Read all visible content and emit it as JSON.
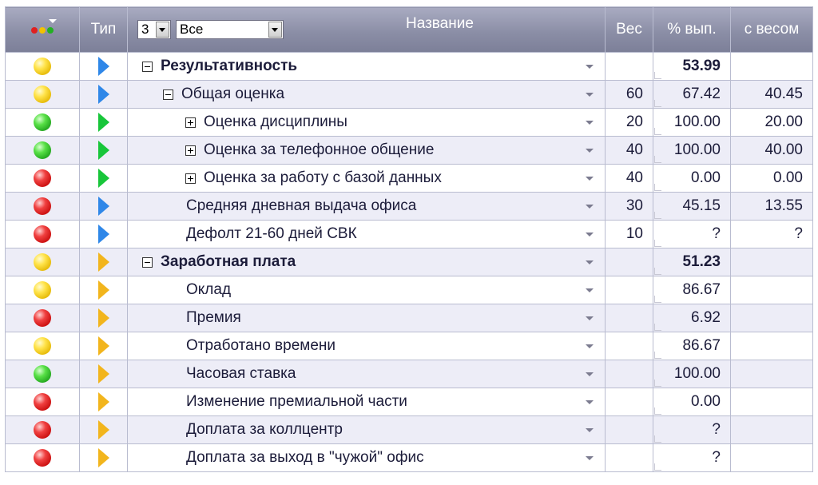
{
  "header": {
    "type_label": "Тип",
    "level_select": "3",
    "filter_select": "Все",
    "name_label": "Название",
    "weight_label": "Вес",
    "pct_label": "% вып.",
    "weighted_label": "с весом"
  },
  "colors": {
    "yellow": "#ffe34a",
    "green": "#1ea11b",
    "red": "#c70b0b",
    "type_blue": "#2f87e8",
    "type_green": "#18c63a",
    "type_orange": "#f2b51d"
  },
  "rows": [
    {
      "status": "yellow",
      "type": "blue",
      "level": 0,
      "toggle": "minus",
      "name": "Результативность",
      "bold": true,
      "weight": "",
      "pct": "53.99",
      "weighted": ""
    },
    {
      "status": "yellow",
      "type": "blue",
      "level": 1,
      "toggle": "minus",
      "name": "Общая оценка",
      "bold": false,
      "weight": "60",
      "pct": "67.42",
      "weighted": "40.45"
    },
    {
      "status": "green",
      "type": "green",
      "level": 2,
      "toggle": "plus",
      "name": "Оценка дисциплины",
      "bold": false,
      "weight": "20",
      "pct": "100.00",
      "weighted": "20.00"
    },
    {
      "status": "green",
      "type": "green",
      "level": 2,
      "toggle": "plus",
      "name": "Оценка за телефонное общение",
      "bold": false,
      "weight": "40",
      "pct": "100.00",
      "weighted": "40.00"
    },
    {
      "status": "red",
      "type": "green",
      "level": 2,
      "toggle": "plus",
      "name": "Оценка за работу с базой данных",
      "bold": false,
      "weight": "40",
      "pct": "0.00",
      "weighted": "0.00"
    },
    {
      "status": "red",
      "type": "blue",
      "level": 1,
      "toggle": "",
      "name": "Средняя дневная выдача офиса",
      "bold": false,
      "weight": "30",
      "pct": "45.15",
      "weighted": "13.55"
    },
    {
      "status": "red",
      "type": "blue",
      "level": 1,
      "toggle": "",
      "name": "Дефолт 21-60 дней СВК",
      "bold": false,
      "weight": "10",
      "pct": "?",
      "weighted": "?"
    },
    {
      "status": "yellow",
      "type": "orange",
      "level": 0,
      "toggle": "minus",
      "name": "Заработная плата",
      "bold": true,
      "weight": "",
      "pct": "51.23",
      "weighted": ""
    },
    {
      "status": "yellow",
      "type": "orange",
      "level": 1,
      "toggle": "",
      "name": "Оклад",
      "bold": false,
      "weight": "",
      "pct": "86.67",
      "weighted": ""
    },
    {
      "status": "red",
      "type": "orange",
      "level": 1,
      "toggle": "",
      "name": "Премия",
      "bold": false,
      "weight": "",
      "pct": "6.92",
      "weighted": ""
    },
    {
      "status": "yellow",
      "type": "orange",
      "level": 1,
      "toggle": "",
      "name": "Отработано времени",
      "bold": false,
      "weight": "",
      "pct": "86.67",
      "weighted": ""
    },
    {
      "status": "green",
      "type": "orange",
      "level": 1,
      "toggle": "",
      "name": "Часовая ставка",
      "bold": false,
      "weight": "",
      "pct": "100.00",
      "weighted": ""
    },
    {
      "status": "red",
      "type": "orange",
      "level": 1,
      "toggle": "",
      "name": "Изменение премиальной части",
      "bold": false,
      "weight": "",
      "pct": "0.00",
      "weighted": ""
    },
    {
      "status": "red",
      "type": "orange",
      "level": 1,
      "toggle": "",
      "name": "Доплата за коллцентр",
      "bold": false,
      "weight": "",
      "pct": "?",
      "weighted": ""
    },
    {
      "status": "red",
      "type": "orange",
      "level": 1,
      "toggle": "",
      "name": "Доплата за выход в \"чужой\" офис",
      "bold": false,
      "weight": "",
      "pct": "?",
      "weighted": ""
    }
  ]
}
